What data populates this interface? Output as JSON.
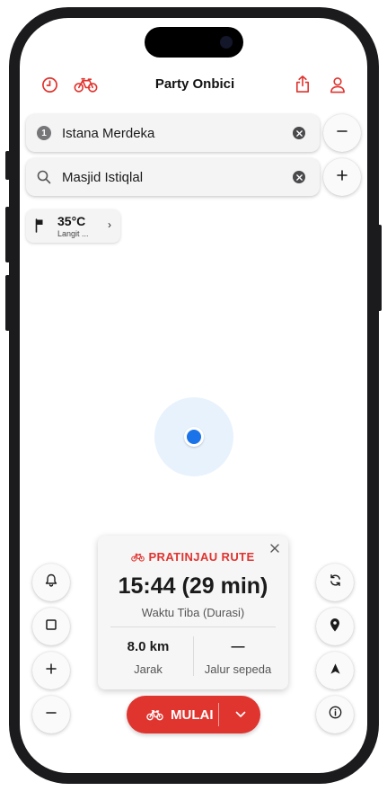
{
  "header": {
    "title": "Party Onbici",
    "icons": [
      "clock-icon",
      "bicycle-icon",
      "share-icon",
      "profile-icon"
    ]
  },
  "route_inputs": [
    {
      "badge": "1",
      "value": "Istana Merdeka",
      "icon": "number-badge"
    },
    {
      "value": "Masjid Istiqlal",
      "icon": "search-icon"
    }
  ],
  "weather": {
    "temperature": "35°C",
    "condition": "Langit ..."
  },
  "route_preview": {
    "heading": "PRATINJAU RUTE",
    "eta": "15:44 (29 min)",
    "eta_label": "Waktu Tiba (Durasi)",
    "distance_value": "8.0 km",
    "distance_label": "Jarak",
    "route_type_value": "—",
    "route_type_label": "Jalur sepeda"
  },
  "start_button": {
    "label": "MULAI"
  },
  "map_controls": {
    "left": [
      "bell-icon",
      "square-icon",
      "plus-icon",
      "minus-icon"
    ],
    "right": [
      "refresh-icon",
      "location-pin-icon",
      "navigation-arrow-icon",
      "info-icon"
    ],
    "top": [
      "minus-icon",
      "plus-icon"
    ]
  },
  "colors": {
    "accent": "#e0342f",
    "location": "#1a73e8",
    "halo": "#e8f2fd"
  }
}
